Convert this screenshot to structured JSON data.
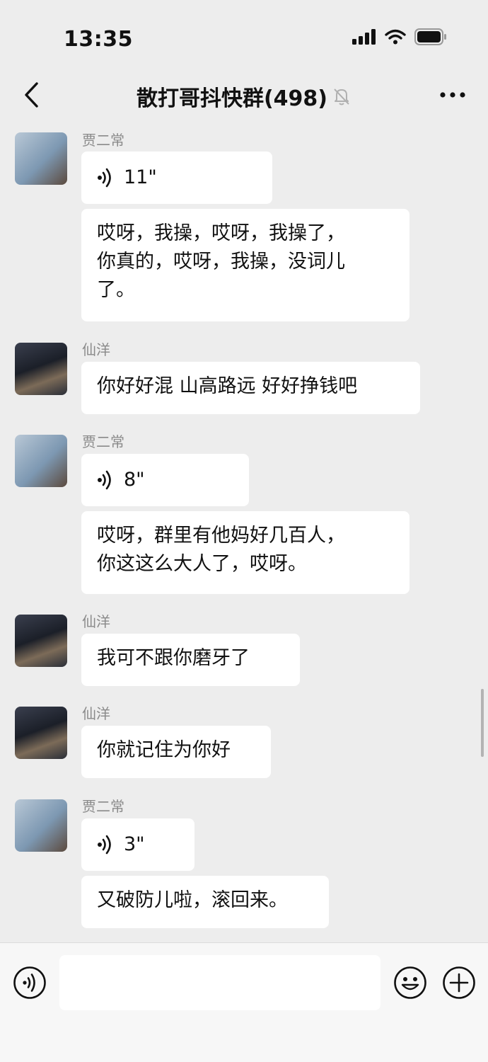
{
  "status_bar": {
    "time": "13:35"
  },
  "header": {
    "title": "散打哥抖快群(498)"
  },
  "messages": [
    {
      "sender": "贾二常",
      "items": [
        {
          "type": "voice",
          "duration": "11\""
        },
        {
          "type": "text",
          "lines": [
            "哎呀，我操，哎呀，我操了，",
            "你真的，哎呀，我操，没词儿",
            "了。"
          ]
        }
      ]
    },
    {
      "sender": "仙洋",
      "items": [
        {
          "type": "text",
          "lines": [
            "你好好混 山高路远 好好挣钱吧"
          ]
        }
      ]
    },
    {
      "sender": "贾二常",
      "items": [
        {
          "type": "voice",
          "duration": "8\""
        },
        {
          "type": "text",
          "lines": [
            "哎呀，群里有他妈好几百人，",
            "你这这么大人了，哎呀。"
          ]
        }
      ]
    },
    {
      "sender": "仙洋",
      "items": [
        {
          "type": "text",
          "lines": [
            "我可不跟你磨牙了"
          ]
        }
      ]
    },
    {
      "sender": "仙洋",
      "items": [
        {
          "type": "text",
          "lines": [
            "你就记住为你好"
          ]
        }
      ]
    },
    {
      "sender": "贾二常",
      "items": [
        {
          "type": "voice",
          "duration": "3\""
        },
        {
          "type": "text",
          "lines": [
            "又破防儿啦，滚回来。"
          ]
        }
      ]
    }
  ],
  "icons": {
    "back": "back-chevron-icon",
    "mute": "muted-bell-icon",
    "more": "more-dots-icon",
    "voice_message": "voice-wave-icon",
    "voice_input": "voice-input-icon",
    "emoji": "emoji-icon",
    "plus": "plus-icon"
  },
  "colors": {
    "background": "#ededed",
    "bubble": "#ffffff",
    "sender_name": "#8a8a8a"
  }
}
